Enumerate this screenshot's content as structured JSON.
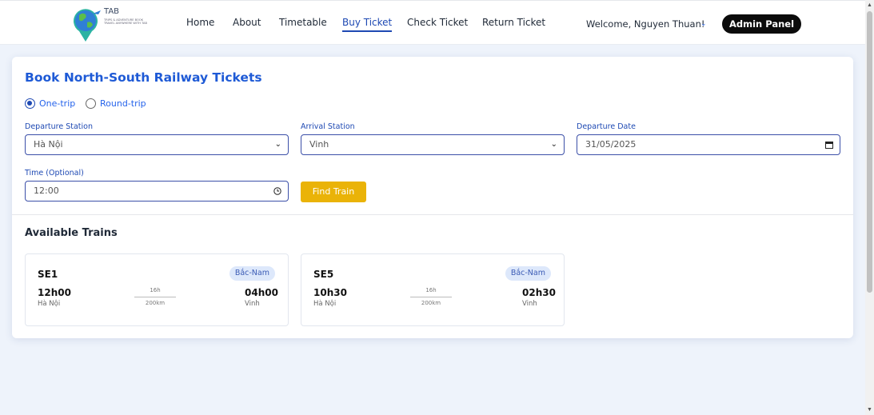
{
  "logo": {
    "text": "TAB",
    "tagline": "TRIPS & ADVENTURE BOOK TRAVEL ANYWHERE WITH TAB"
  },
  "nav": {
    "home": "Home",
    "about": "About",
    "timetable": "Timetable",
    "buy_ticket": "Buy Ticket",
    "check_ticket": "Check Ticket",
    "return_ticket": "Return Ticket",
    "active": "buy_ticket"
  },
  "user": {
    "welcome": "Welcome, Nguyen Thuan!",
    "admin_button": "Admin Panel"
  },
  "booking": {
    "title": "Book North-South Railway Tickets",
    "trip_types": [
      "One-trip",
      "Round-trip"
    ],
    "selected_trip_type": "One-trip",
    "departure_label": "Departure Station",
    "departure_value": "Hà Nội",
    "arrival_label": "Arrival Station",
    "arrival_value": "Vinh",
    "date_label": "Departure Date",
    "date_value": "31/05/2025",
    "time_label": "Time (Optional)",
    "time_value": "12:00",
    "find_button": "Find Train"
  },
  "available": {
    "title": "Available Trains",
    "trains": [
      {
        "code": "SE1",
        "route": "Bắc-Nam",
        "depart_time": "12h00",
        "depart_station": "Hà Nội",
        "duration": "16h",
        "distance": "200km",
        "arrive_time": "04h00",
        "arrive_station": "Vinh"
      },
      {
        "code": "SE5",
        "route": "Bắc-Nam",
        "depart_time": "10h30",
        "depart_station": "Hà Nội",
        "duration": "16h",
        "distance": "200km",
        "arrive_time": "02h30",
        "arrive_station": "Vinh"
      }
    ]
  },
  "colors": {
    "primary": "#1e5ad6",
    "accent": "#eab308",
    "dark": "#0b0b0b",
    "badge_bg": "#dde8fb"
  }
}
